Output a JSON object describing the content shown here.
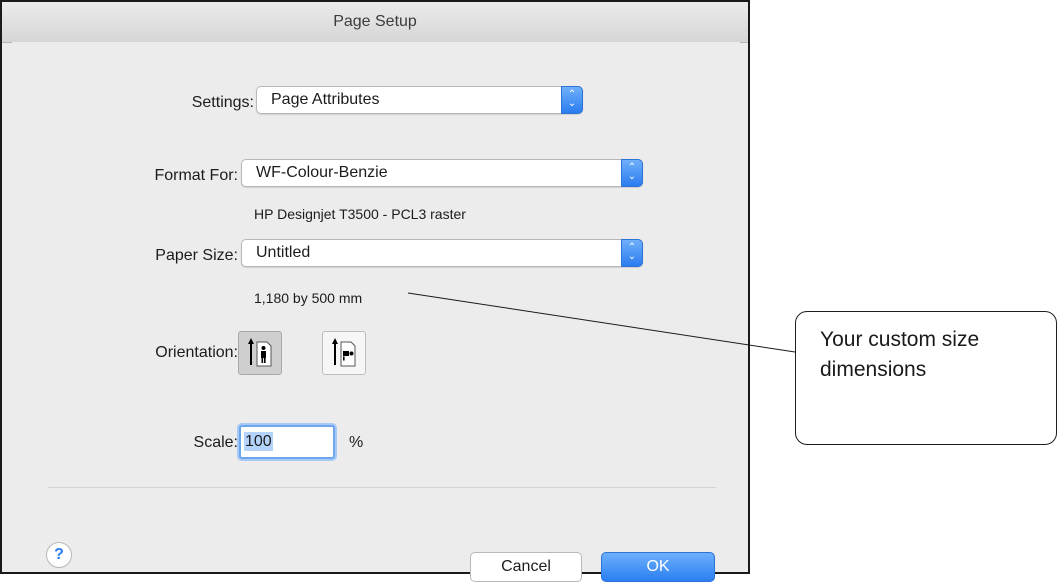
{
  "window": {
    "title": "Page Setup"
  },
  "settings": {
    "label": "Settings:",
    "value": "Page Attributes"
  },
  "format_for": {
    "label": "Format For:",
    "value": "WF-Colour-Benzie",
    "printer_desc": "HP Designjet T3500 - PCL3 raster"
  },
  "paper_size": {
    "label": "Paper Size:",
    "value": "Untitled",
    "dimensions": "1,180 by 500 mm"
  },
  "orientation": {
    "label": "Orientation:",
    "options": [
      "portrait",
      "landscape"
    ],
    "selected": "portrait"
  },
  "scale": {
    "label": "Scale:",
    "value": "100",
    "unit": "%"
  },
  "buttons": {
    "help": "?",
    "cancel": "Cancel",
    "ok": "OK"
  },
  "annotation": {
    "line1": "Your custom size",
    "line2": "dimensions"
  },
  "colors": {
    "accent": "#2a7cf0",
    "window_bg": "#ececec"
  },
  "icons": {
    "stepper": "up-down-chevron-icon",
    "portrait": "portrait-orientation-icon",
    "landscape": "landscape-orientation-icon",
    "help": "help-icon"
  }
}
